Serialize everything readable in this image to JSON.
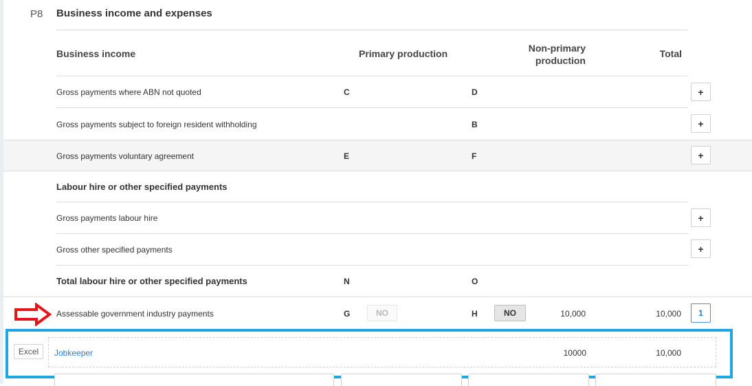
{
  "section": {
    "code": "P8",
    "title": "Business income and expenses"
  },
  "columns": {
    "label": "Business income",
    "primary": "Primary production",
    "non_primary_line1": "Non-primary",
    "non_primary_line2": "production",
    "total": "Total"
  },
  "rows": [
    {
      "label": "Gross payments where ABN not quoted",
      "primary_code": "C",
      "non_primary_code": "D",
      "action": "+"
    },
    {
      "label": "Gross payments subject to foreign resident withholding",
      "primary_code": "",
      "non_primary_code": "B",
      "action": "+"
    },
    {
      "label": "Gross payments voluntary agreement",
      "primary_code": "E",
      "non_primary_code": "F",
      "action": "+"
    },
    {
      "label": "Labour hire or other specified payments"
    },
    {
      "label": "Gross payments labour hire",
      "action": "+"
    },
    {
      "label": "Gross other specified payments",
      "action": "+"
    },
    {
      "label": "Total labour hire or other specified payments",
      "primary_code": "N",
      "non_primary_code": "O"
    },
    {
      "label": "Assessable government industry payments",
      "primary_code": "G",
      "primary_toggle": "NO",
      "non_primary_code": "H",
      "non_primary_toggle": "NO",
      "non_primary_value": "10,000",
      "total": "10,000",
      "count": "1"
    }
  ],
  "detail_row": {
    "excel_label": "Excel",
    "description": "Jobkeeper",
    "amount": "10000",
    "total": "10,000"
  },
  "colors": {
    "accent_blue": "#1ea7e1",
    "link_blue": "#2a7bd1",
    "arrow_red": "#e8141b"
  }
}
